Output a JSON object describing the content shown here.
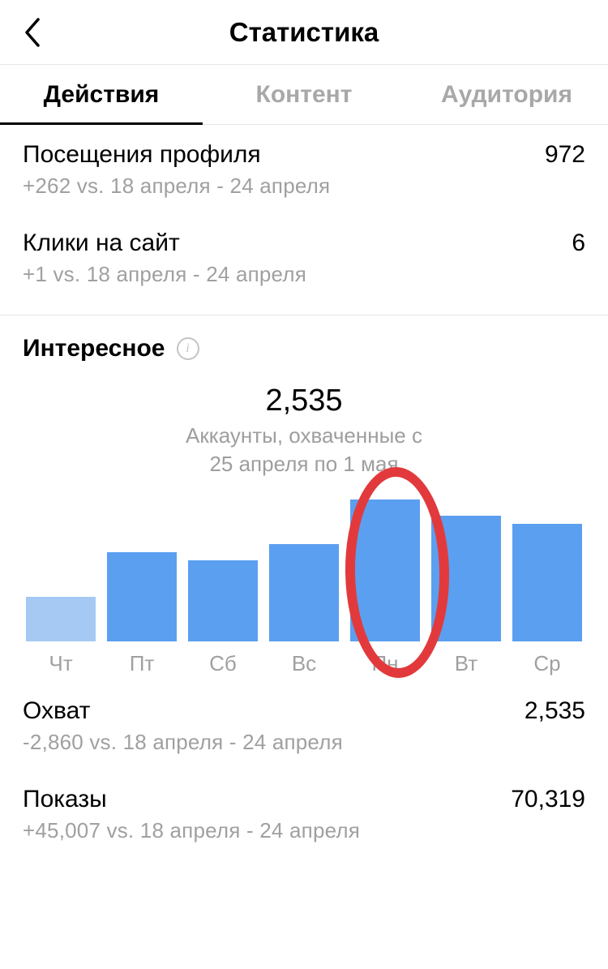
{
  "header": {
    "title": "Статистика"
  },
  "tabs": [
    {
      "label": "Действия",
      "active": true
    },
    {
      "label": "Контент",
      "active": false
    },
    {
      "label": "Аудитория",
      "active": false
    }
  ],
  "metrics": [
    {
      "label": "Посещения профиля",
      "value": "972",
      "sub": "+262 vs. 18 апреля - 24 апреля"
    },
    {
      "label": "Клики на сайт",
      "value": "6",
      "sub": "+1 vs. 18 апреля - 24 апреля"
    }
  ],
  "section": {
    "title": "Интересное",
    "chart_number": "2,535",
    "chart_caption_line1": "Аккаунты, охваченные с",
    "chart_caption_line2": "25 апреля по 1 мая"
  },
  "chart_data": {
    "type": "bar",
    "categories": [
      "Чт",
      "Пт",
      "Сб",
      "Вс",
      "Пн",
      "Вт",
      "Ср"
    ],
    "values": [
      55,
      110,
      100,
      120,
      175,
      155,
      145
    ],
    "highlight_index": 4,
    "light_index": 0,
    "title": "Аккаунты, охваченные с 25 апреля по 1 мая",
    "total": "2,535",
    "ylabel": "",
    "xlabel": ""
  },
  "bottom_metrics": [
    {
      "label": "Охват",
      "value": "2,535",
      "sub": "-2,860 vs. 18 апреля - 24 апреля"
    },
    {
      "label": "Показы",
      "value": "70,319",
      "sub": "+45,007 vs. 18 апреля - 24 апреля"
    }
  ]
}
